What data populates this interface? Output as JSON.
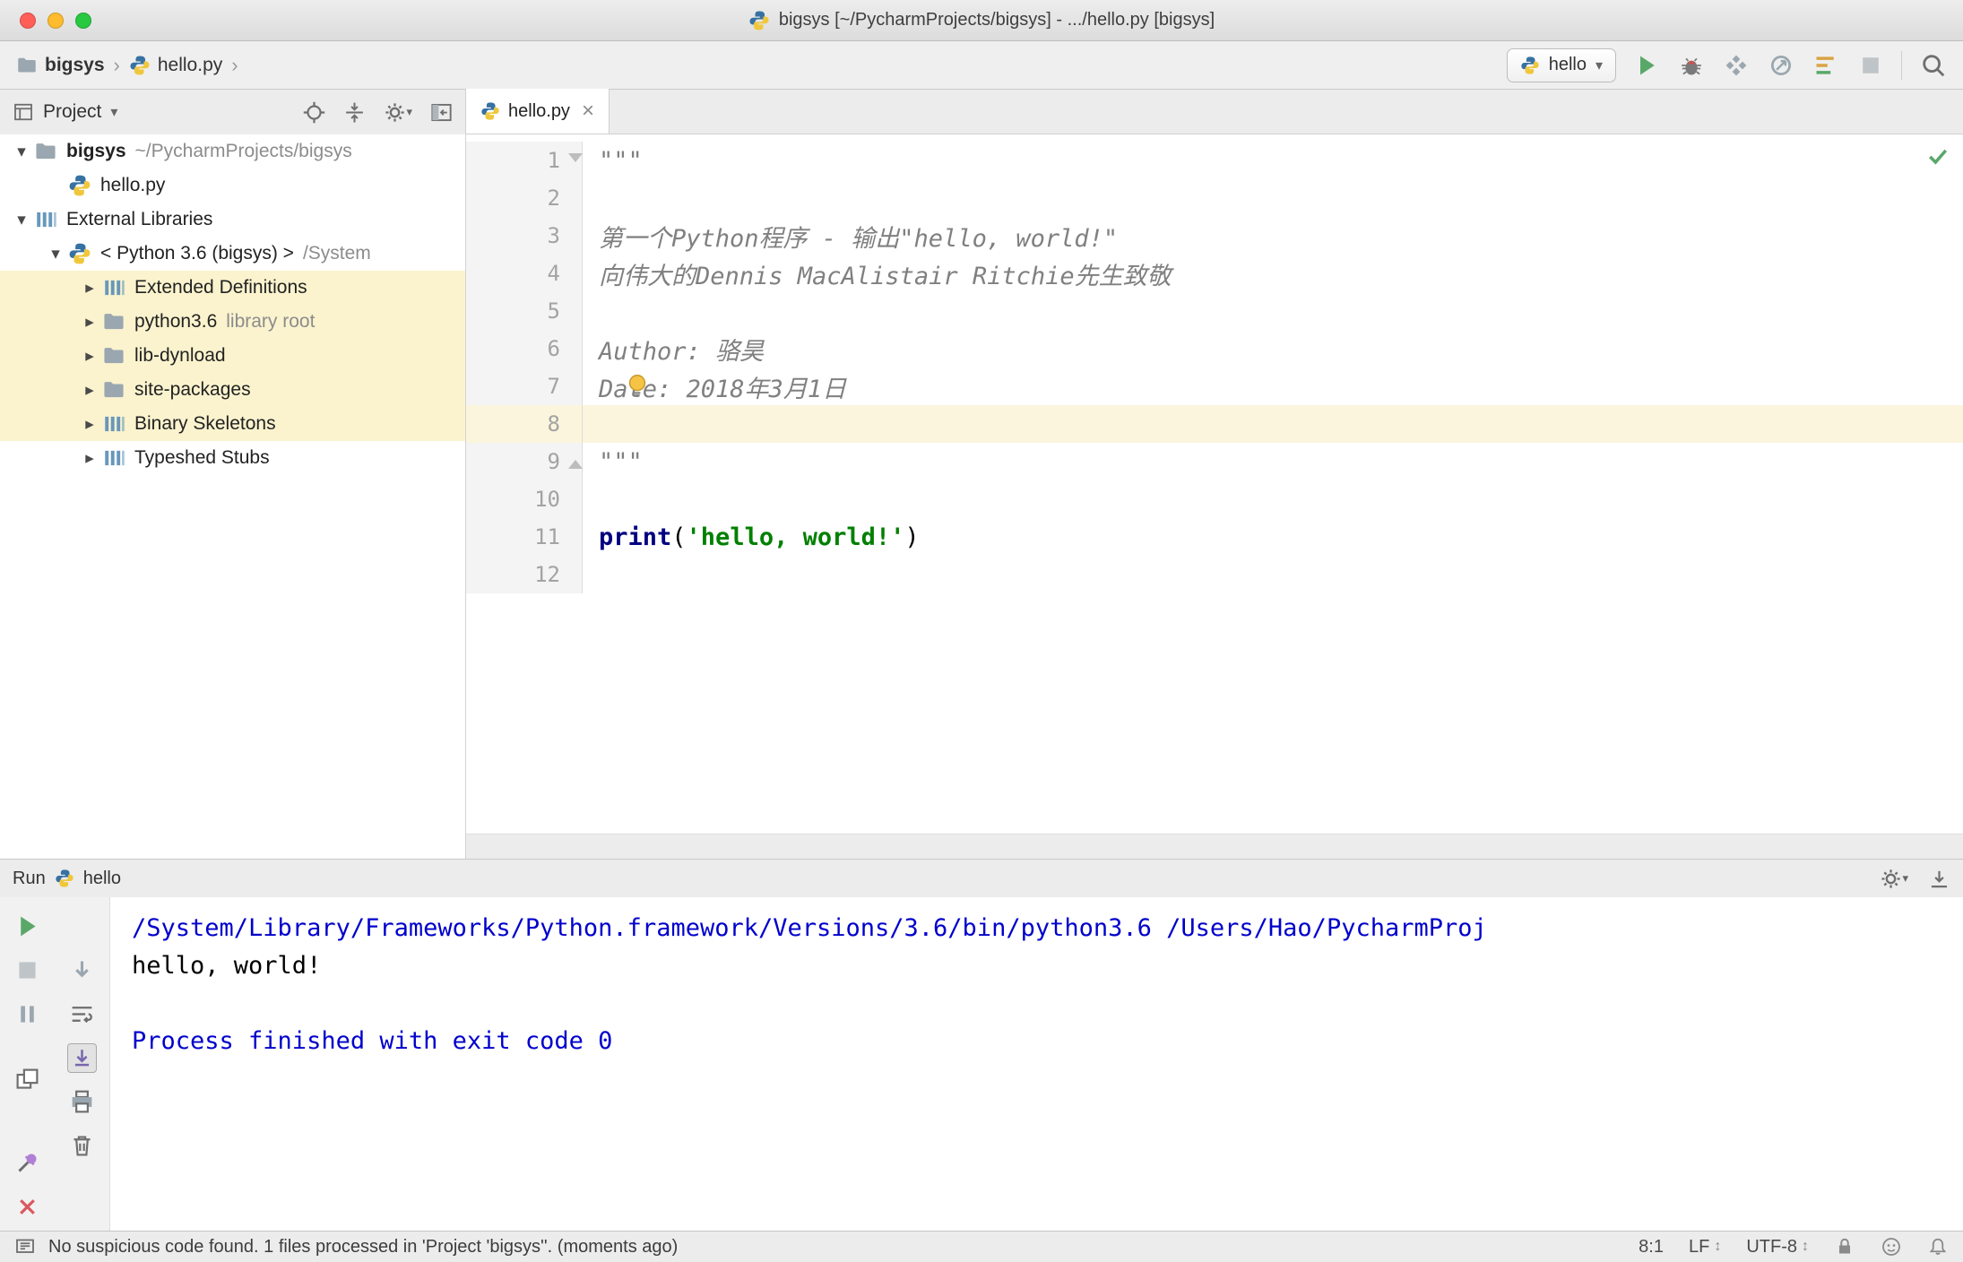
{
  "titlebar": {
    "title": "bigsys [~/PycharmProjects/bigsys] - .../hello.py [bigsys]"
  },
  "toolbar": {
    "breadcrumbs": [
      {
        "label": "bigsys",
        "icon": "folder",
        "bold": true
      },
      {
        "label": "hello.py",
        "icon": "python",
        "bold": false
      }
    ],
    "run_config": "hello",
    "actions": [
      "run",
      "debug",
      "coverage",
      "profiler",
      "coverage-report",
      "stop"
    ]
  },
  "project": {
    "title": "Project",
    "tree": [
      {
        "label": "bigsys",
        "hint": "~/PycharmProjects/bigsys",
        "icon": "folder",
        "arrow": "down",
        "indent": 0,
        "bold": true
      },
      {
        "label": "hello.py",
        "icon": "python",
        "arrow": "",
        "indent": 1
      },
      {
        "label": "External Libraries",
        "icon": "library",
        "arrow": "down",
        "indent": 0
      },
      {
        "label": "< Python 3.6 (bigsys) >",
        "hint": "/System",
        "icon": "python",
        "arrow": "down",
        "indent": 1
      },
      {
        "label": "Extended Definitions",
        "icon": "library",
        "arrow": "right",
        "indent": 2,
        "highlight": true
      },
      {
        "label": "python3.6",
        "hint": "library root",
        "icon": "folder",
        "arrow": "right",
        "indent": 2,
        "highlight": true
      },
      {
        "label": "lib-dynload",
        "icon": "folder",
        "arrow": "right",
        "indent": 2,
        "highlight": true
      },
      {
        "label": "site-packages",
        "icon": "folder",
        "arrow": "right",
        "indent": 2,
        "highlight": true
      },
      {
        "label": "Binary Skeletons",
        "icon": "library",
        "arrow": "right",
        "indent": 2,
        "highlight": true
      },
      {
        "label": "Typeshed Stubs",
        "icon": "library",
        "arrow": "right",
        "indent": 2
      }
    ]
  },
  "editor": {
    "tab": "hello.py",
    "current_line": 8,
    "lines": [
      {
        "n": 1,
        "segs": [
          [
            "doc",
            "\"\"\""
          ]
        ],
        "fold": "open-top"
      },
      {
        "n": 2,
        "segs": []
      },
      {
        "n": 3,
        "segs": [
          [
            "doc",
            "第一个Python程序 - 输出\"hello, world!\""
          ]
        ]
      },
      {
        "n": 4,
        "segs": [
          [
            "doc",
            "向伟大的Dennis MacAlistair Ritchie先生致敬"
          ]
        ]
      },
      {
        "n": 5,
        "segs": []
      },
      {
        "n": 6,
        "segs": [
          [
            "doc",
            "Author: 骆昊"
          ]
        ]
      },
      {
        "n": 7,
        "segs": [
          [
            "doc",
            "Date: 2018年3月1日"
          ]
        ],
        "bulb": true
      },
      {
        "n": 8,
        "segs": [],
        "current": true
      },
      {
        "n": 9,
        "segs": [
          [
            "doc",
            "\"\"\""
          ]
        ],
        "fold": "open-bottom"
      },
      {
        "n": 10,
        "segs": []
      },
      {
        "n": 11,
        "segs": [
          [
            "kw",
            "print"
          ],
          [
            "plain",
            "("
          ],
          [
            "str",
            "'hello, world!'"
          ],
          [
            "plain",
            ")"
          ]
        ]
      },
      {
        "n": 12,
        "segs": []
      }
    ]
  },
  "run": {
    "title": "Run",
    "config": "hello",
    "toolbar_col1": [
      "rerun",
      "stop",
      "pause",
      "restore-layout",
      "pin",
      "close",
      "more"
    ],
    "toolbar_col2": [
      "scroll-down",
      "soft-wrap",
      "scroll-end",
      "print",
      "clear"
    ],
    "console": [
      {
        "type": "system",
        "text": "/System/Library/Frameworks/Python.framework/Versions/3.6/bin/python3.6 /Users/Hao/PycharmProj"
      },
      {
        "type": "stdout",
        "text": "hello, world!"
      },
      {
        "type": "stdout",
        "text": ""
      },
      {
        "type": "system",
        "text": "Process finished with exit code 0"
      }
    ]
  },
  "statusbar": {
    "message": "No suspicious code found. 1 files processed in 'Project 'bigsys''. (moments ago)",
    "caret": "8:1",
    "line_sep": "LF",
    "encoding": "UTF-8"
  },
  "colors": {
    "run_green": "#59a869",
    "caret_row": "#faf5dc",
    "library_highlight": "#faf3ce",
    "console_system_blue": "#0000cc",
    "keyword_blue": "#000080",
    "string_green": "#008000",
    "docstring_gray": "#808080"
  }
}
